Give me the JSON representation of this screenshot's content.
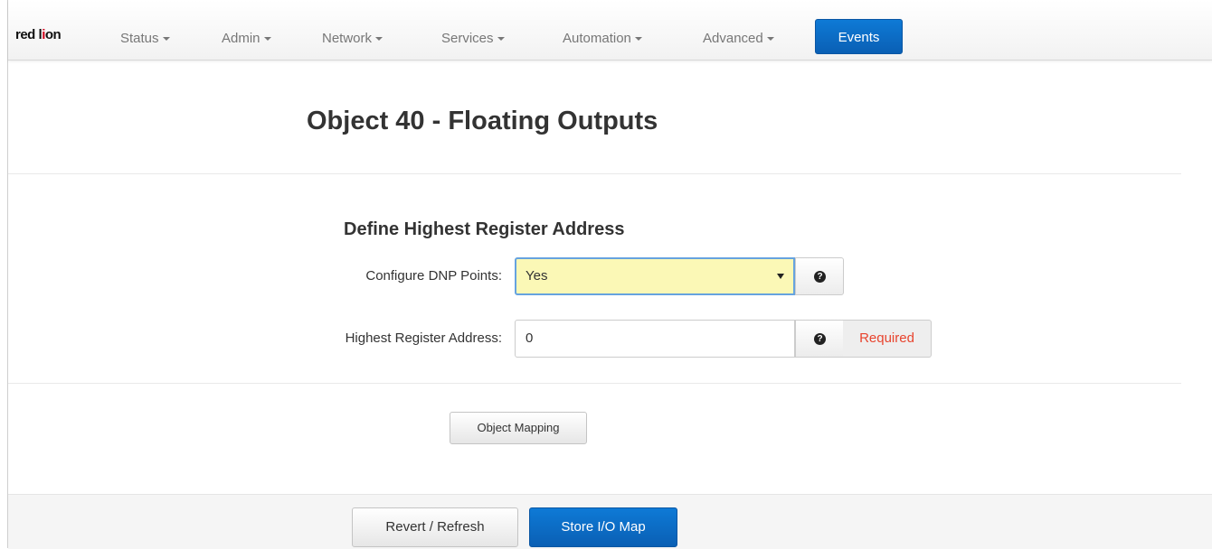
{
  "brand": {
    "logo_text_left": "red l",
    "logo_mark": "i",
    "logo_text_right": "on"
  },
  "nav": {
    "items": [
      {
        "label": "Status"
      },
      {
        "label": "Admin"
      },
      {
        "label": "Network"
      },
      {
        "label": "Services"
      },
      {
        "label": "Automation"
      },
      {
        "label": "Advanced"
      }
    ],
    "active": {
      "label": "Events"
    }
  },
  "page": {
    "title": "Object 40 - Floating Outputs"
  },
  "form": {
    "section_title": "Define Highest Register Address",
    "configure_dnp": {
      "label": "Configure DNP Points:",
      "value": "Yes"
    },
    "highest_register": {
      "label": "Highest Register Address:",
      "value": "0",
      "required_text": "Required"
    },
    "help_glyph": "?",
    "object_mapping_label": "Object Mapping"
  },
  "footer": {
    "revert_label": "Revert / Refresh",
    "store_label": "Store I/O Map"
  },
  "colors": {
    "primary": "#0a6cc7",
    "select_highlight": "#fbf8b6",
    "required": "#e8442e"
  },
  "icons": {
    "help": "question-circle-icon",
    "dropdown": "caret-down-icon"
  }
}
